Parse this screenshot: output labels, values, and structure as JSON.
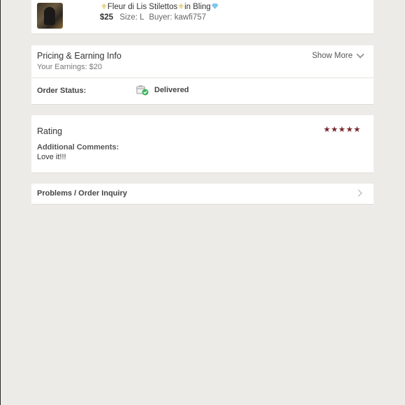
{
  "item": {
    "title_text": "Fleur di Lis Stilettos",
    "title_middle": "in Bling",
    "price": "$25",
    "size": "Size: L",
    "buyer": "Buyer: kawfi757"
  },
  "pricing": {
    "title": "Pricing & Earning Info",
    "earnings": "Your Earnings: $20",
    "show_more": "Show More"
  },
  "order_status": {
    "label": "Order Status:",
    "value": "Delivered"
  },
  "rating": {
    "title": "Rating",
    "stars": 5,
    "stars_display": "★★★★★",
    "comments_label": "Additional Comments:",
    "comments": "Love it!!!"
  },
  "inquiry": {
    "label": "Problems / Order Inquiry"
  },
  "colors": {
    "star": "#7b2a2f",
    "delivered_check": "#3ab55c",
    "fleur": "#d6b735",
    "diamond": "#7ec8ec"
  }
}
